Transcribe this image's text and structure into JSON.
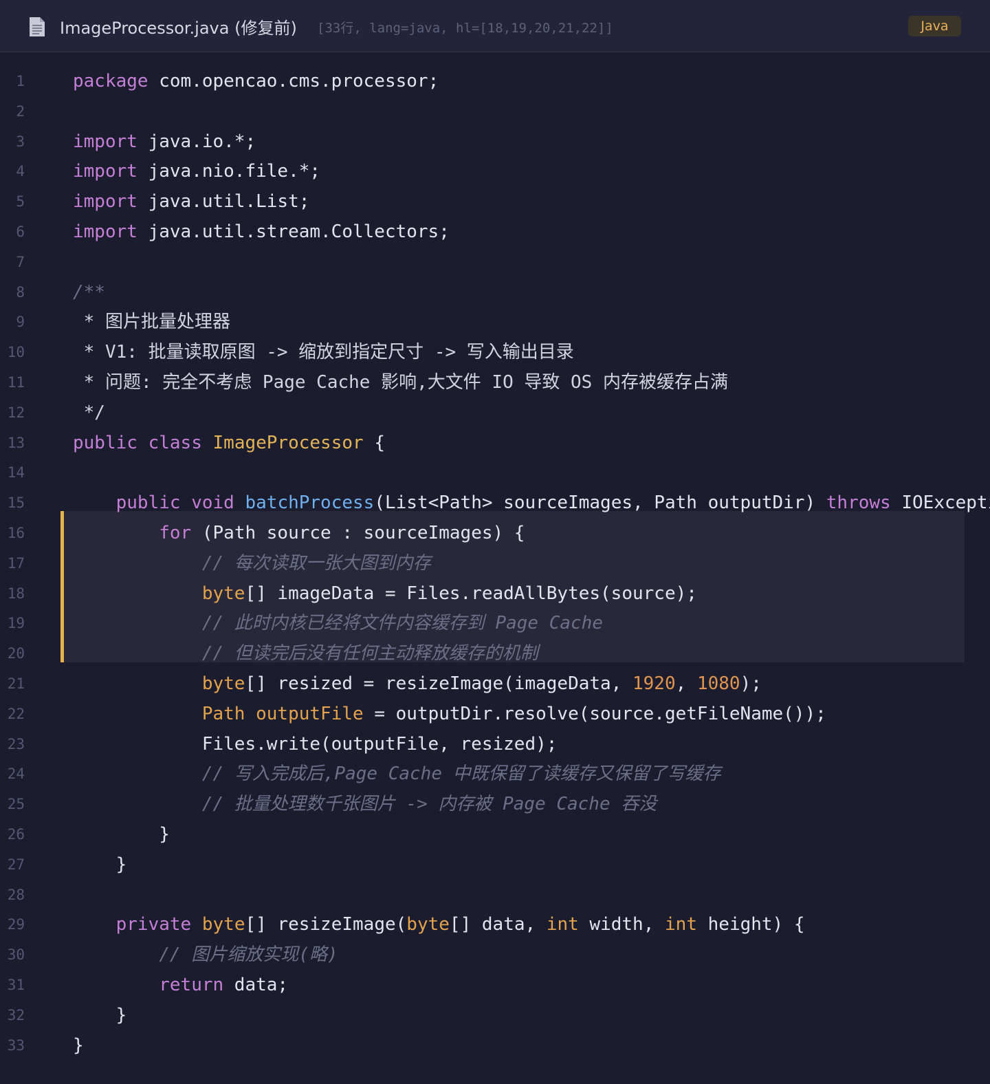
{
  "header": {
    "file_name": "ImageProcessor.java (修复前)",
    "meta": "[33行, lang=java, hl=[18,19,20,21,22]]",
    "language_badge": "Java",
    "icon": "file-icon"
  },
  "highlight_lines": [
    18,
    19,
    20,
    21,
    22
  ],
  "lines": [
    {
      "n": "1",
      "tokens": [
        [
          "kw",
          "package"
        ],
        [
          "p",
          " com.opencao.cms.processor;"
        ]
      ]
    },
    {
      "n": "2",
      "tokens": []
    },
    {
      "n": "3",
      "tokens": [
        [
          "kw",
          "import"
        ],
        [
          "p",
          " java.io.*;"
        ]
      ]
    },
    {
      "n": "4",
      "tokens": [
        [
          "kw",
          "import"
        ],
        [
          "p",
          " java.nio.file.*;"
        ]
      ]
    },
    {
      "n": "5",
      "tokens": [
        [
          "kw",
          "import"
        ],
        [
          "p",
          " java.util.List;"
        ]
      ]
    },
    {
      "n": "6",
      "tokens": [
        [
          "kw",
          "import"
        ],
        [
          "p",
          " java.util.stream.Collectors;"
        ]
      ]
    },
    {
      "n": "7",
      "tokens": []
    },
    {
      "n": "8",
      "tokens": [
        [
          "cm",
          "/**"
        ]
      ]
    },
    {
      "n": "9",
      "tokens": [
        [
          "doc",
          " * 图片批量处理器"
        ]
      ]
    },
    {
      "n": "10",
      "tokens": [
        [
          "doc",
          " * V1: 批量读取原图 -> 缩放到指定尺寸 -> 写入输出目录"
        ]
      ]
    },
    {
      "n": "11",
      "tokens": [
        [
          "doc",
          " * 问题: 完全不考虑 Page Cache 影响,大文件 IO 导致 OS 内存被缓存占满"
        ]
      ]
    },
    {
      "n": "12",
      "tokens": [
        [
          "doc",
          " */"
        ]
      ]
    },
    {
      "n": "13",
      "tokens": [
        [
          "kw",
          "public"
        ],
        [
          "p",
          " "
        ],
        [
          "kw",
          "class"
        ],
        [
          "p",
          " "
        ],
        [
          "cls",
          "ImageProcessor"
        ],
        [
          "p",
          " {"
        ]
      ]
    },
    {
      "n": "14",
      "tokens": []
    },
    {
      "n": "15",
      "tokens": [
        [
          "p",
          "    "
        ],
        [
          "kw",
          "public"
        ],
        [
          "p",
          " "
        ],
        [
          "kw",
          "void"
        ],
        [
          "p",
          " "
        ],
        [
          "fn",
          "batchProcess"
        ],
        [
          "p",
          "(List<Path> sourceImages, Path outputDir) "
        ],
        [
          "kw",
          "throws"
        ],
        [
          "p",
          " IOException {"
        ]
      ]
    },
    {
      "n": "16",
      "tokens": [
        [
          "p",
          "        "
        ],
        [
          "kw",
          "for"
        ],
        [
          "p",
          " (Path source : sourceImages) {"
        ]
      ]
    },
    {
      "n": "17",
      "tokens": [
        [
          "p",
          "            "
        ],
        [
          "cm",
          "// 每次读取一张大图到内存"
        ]
      ]
    },
    {
      "n": "18",
      "tokens": [
        [
          "p",
          "            "
        ],
        [
          "ty",
          "byte"
        ],
        [
          "p",
          "[] imageData = Files.readAllBytes(source);"
        ]
      ]
    },
    {
      "n": "19",
      "tokens": [
        [
          "p",
          "            "
        ],
        [
          "cm",
          "// 此时内核已经将文件内容缓存到 Page Cache"
        ]
      ]
    },
    {
      "n": "20",
      "tokens": [
        [
          "p",
          "            "
        ],
        [
          "cm",
          "// 但读完后没有任何主动释放缓存的机制"
        ]
      ]
    },
    {
      "n": "21",
      "tokens": [
        [
          "p",
          "            "
        ],
        [
          "ty",
          "byte"
        ],
        [
          "p",
          "[] resized = resizeImage(imageData, "
        ],
        [
          "num",
          "1920"
        ],
        [
          "p",
          ", "
        ],
        [
          "num",
          "1080"
        ],
        [
          "p",
          ");"
        ]
      ]
    },
    {
      "n": "22",
      "tokens": [
        [
          "p",
          "            "
        ],
        [
          "ty",
          "Path"
        ],
        [
          "p",
          " "
        ],
        [
          "ty",
          "outputFile"
        ],
        [
          "p",
          " = outputDir.resolve(source.getFileName());"
        ]
      ]
    },
    {
      "n": "23",
      "tokens": [
        [
          "p",
          "            Files.write(outputFile, resized);"
        ]
      ]
    },
    {
      "n": "24",
      "tokens": [
        [
          "p",
          "            "
        ],
        [
          "cm",
          "// 写入完成后,Page Cache 中既保留了读缓存又保留了写缓存"
        ]
      ]
    },
    {
      "n": "25",
      "tokens": [
        [
          "p",
          "            "
        ],
        [
          "cm",
          "// 批量处理数千张图片 -> 内存被 Page Cache 吞没"
        ]
      ]
    },
    {
      "n": "26",
      "tokens": [
        [
          "p",
          "        }"
        ]
      ]
    },
    {
      "n": "27",
      "tokens": [
        [
          "p",
          "    }"
        ]
      ]
    },
    {
      "n": "28",
      "tokens": []
    },
    {
      "n": "29",
      "tokens": [
        [
          "p",
          "    "
        ],
        [
          "kw",
          "private"
        ],
        [
          "p",
          " "
        ],
        [
          "ty",
          "byte"
        ],
        [
          "p",
          "[] resizeImage("
        ],
        [
          "ty",
          "byte"
        ],
        [
          "p",
          "[] data, "
        ],
        [
          "ty",
          "int"
        ],
        [
          "p",
          " width, "
        ],
        [
          "ty",
          "int"
        ],
        [
          "p",
          " height) {"
        ]
      ]
    },
    {
      "n": "30",
      "tokens": [
        [
          "p",
          "        "
        ],
        [
          "cm",
          "// 图片缩放实现(略)"
        ]
      ]
    },
    {
      "n": "31",
      "tokens": [
        [
          "p",
          "        "
        ],
        [
          "kw",
          "return"
        ],
        [
          "p",
          " data;"
        ]
      ]
    },
    {
      "n": "32",
      "tokens": [
        [
          "p",
          "    }"
        ]
      ]
    },
    {
      "n": "33",
      "tokens": [
        [
          "p",
          "}"
        ]
      ]
    }
  ]
}
